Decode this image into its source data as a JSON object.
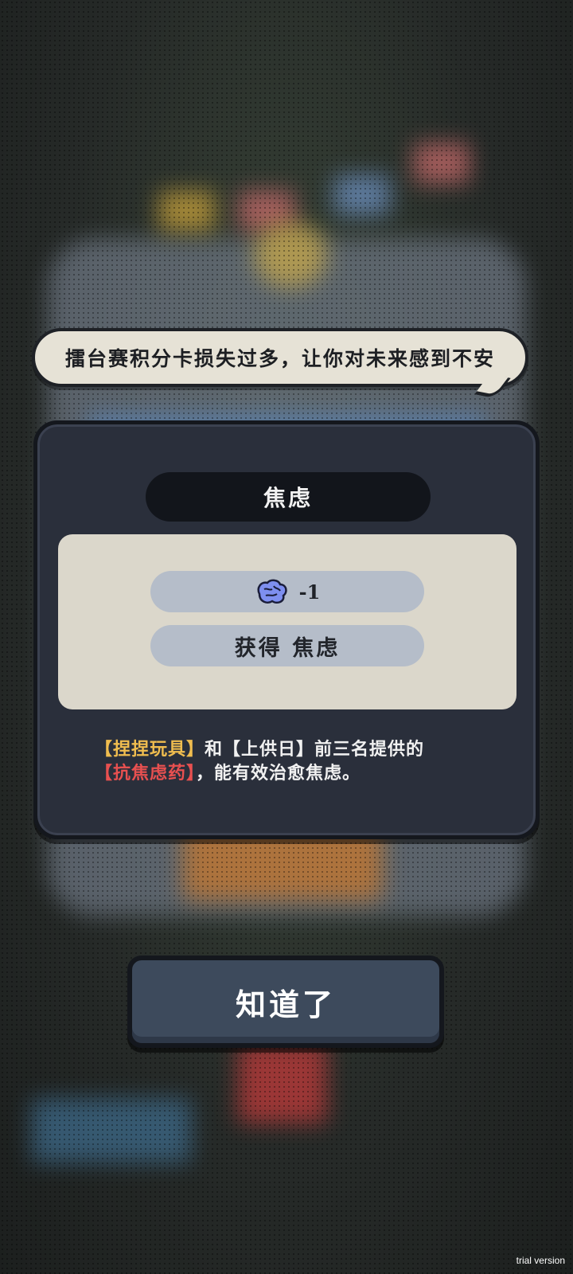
{
  "bubble": {
    "text": "擂台赛积分卡损失过多，让你对未来感到不安"
  },
  "panel": {
    "title": "焦虑",
    "stat_icon": "brain-icon",
    "stat_value": "-1",
    "gain_text": "获得 焦虑",
    "desc": {
      "part1": "【捏捏玩具】",
      "part2": "和【上供日】前三名提供的",
      "part3": "【抗焦虑药】",
      "part4": "，能有效治愈焦虑。"
    }
  },
  "button": {
    "label": "知道了"
  },
  "watermark": "trial version",
  "colors": {
    "panel_bg": "#2a2f3b",
    "card_bg": "#dbd7cb",
    "pill_bg": "#b5bdc9",
    "highlight_yellow": "#f0bd4f",
    "highlight_red": "#e85050",
    "button_bg": "#3d4a5c"
  }
}
